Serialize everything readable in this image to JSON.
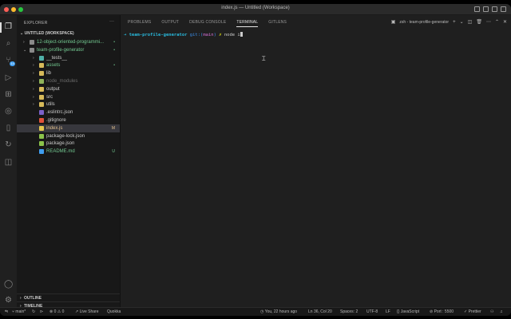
{
  "window": {
    "title": "index.js — Untitled (Workspace)"
  },
  "activity": {
    "source_control_badge": "14"
  },
  "sidebar": {
    "header": "EXPLORER",
    "more": "···",
    "workspace": "UNTITLED (WORKSPACE)",
    "rows": [
      {
        "label": "12-object-oriented-programmi...",
        "status": "•",
        "color": "#73c991",
        "icon_color": "#8a8a8a",
        "chevron": "›",
        "indent": 16
      },
      {
        "label": "team-profile-generator",
        "status": "•",
        "color": "#73c991",
        "icon_color": "#8a8a8a",
        "chevron": "⌄",
        "indent": 16
      },
      {
        "label": "__tests__",
        "status": "",
        "color": "#cccccc",
        "icon_color": "#4fb0a8",
        "chevron": "›",
        "indent": 28
      },
      {
        "label": "assets",
        "status": "•",
        "color": "#73c991",
        "icon_color": "#d7ba5a",
        "chevron": "›",
        "indent": 28
      },
      {
        "label": "lib",
        "status": "",
        "color": "#cccccc",
        "icon_color": "#d7ba5a",
        "chevron": "›",
        "indent": 28
      },
      {
        "label": "node_modules",
        "status": "",
        "color": "#6a6a6a",
        "icon_color": "#8fb35a",
        "chevron": "›",
        "indent": 28
      },
      {
        "label": "output",
        "status": "",
        "color": "#cccccc",
        "icon_color": "#d7ba5a",
        "chevron": "›",
        "indent": 28
      },
      {
        "label": "src",
        "status": "",
        "color": "#cccccc",
        "icon_color": "#d7ba5a",
        "chevron": "›",
        "indent": 28
      },
      {
        "label": "utils",
        "status": "",
        "color": "#cccccc",
        "icon_color": "#d7ba5a",
        "chevron": "›",
        "indent": 28
      },
      {
        "label": ".eslintrc.json",
        "status": "",
        "color": "#cccccc",
        "icon_color": "#7b61c9",
        "chevron": "",
        "indent": 28
      },
      {
        "label": ".gitignore",
        "status": "",
        "color": "#cccccc",
        "icon_color": "#e0523b",
        "chevron": "",
        "indent": 28
      },
      {
        "label": "index.js",
        "status": "M",
        "color": "#e2c08d",
        "icon_color": "#e5c74d",
        "chevron": "",
        "indent": 28
      },
      {
        "label": "package-lock.json",
        "status": "",
        "color": "#cccccc",
        "icon_color": "#8bc34a",
        "chevron": "",
        "indent": 28
      },
      {
        "label": "package.json",
        "status": "",
        "color": "#cccccc",
        "icon_color": "#8bc34a",
        "chevron": "",
        "indent": 28
      },
      {
        "label": "README.md",
        "status": "U",
        "color": "#73c991",
        "icon_color": "#3f9ef0",
        "chevron": "",
        "indent": 28
      }
    ],
    "outline": "OUTLINE",
    "timeline": "TIMELINE"
  },
  "panel": {
    "tabs": [
      "PROBLEMS",
      "OUTPUT",
      "DEBUG CONSOLE",
      "TERMINAL",
      "GITLENS"
    ],
    "active_tab": "TERMINAL",
    "terminal_name": "zsh - team-profile-generator",
    "terminal": {
      "arrow": "➜",
      "dir": "team-profile-generator",
      "git_label": "git:(",
      "branch": "main",
      "git_close": ")",
      "cross": "✗",
      "command": "node i"
    }
  },
  "statusbar": {
    "branch": "main*",
    "errors": "0",
    "warnings": "0",
    "live_share": "Live Share",
    "quokka": "Quokka",
    "blame": "You, 22 hours ago",
    "position": "Ln 36, Col 20",
    "spaces": "Spaces: 2",
    "encoding": "UTF-8",
    "eol": "LF",
    "language": "JavaScript",
    "port": "Port : 5500",
    "prettier": "Prettier"
  },
  "colors": {
    "accent": "#3f9ef0",
    "terminal_arrow": "#29b8db",
    "terminal_dir": "#29b8db",
    "git_label": "#3b8eea",
    "branch": "#d670d6",
    "cross": "#e5e510",
    "modified": "#e2c08d",
    "untracked": "#73c991"
  }
}
